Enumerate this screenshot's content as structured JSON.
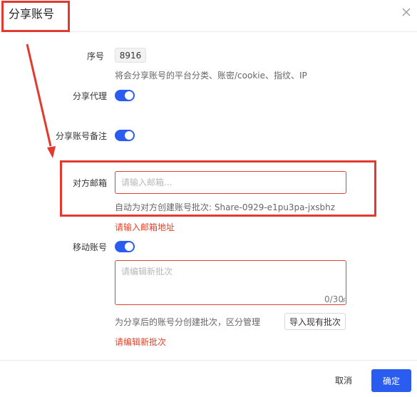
{
  "dialog": {
    "title": "分享账号",
    "close_icon": "close-icon"
  },
  "form": {
    "sequence": {
      "label": "序号",
      "value": "8916",
      "hint": "将会分享账号的平台分类、账密/cookie、指纹、IP"
    },
    "share_proxy": {
      "label": "分享代理",
      "enabled": true
    },
    "share_remark": {
      "label": "分享账号备注",
      "enabled": true
    },
    "email": {
      "label": "对方邮箱",
      "placeholder": "请输入邮箱...",
      "value": "",
      "hint": "自动为对方创建账号批次: Share-0929-e1pu3pa-jxsbhz",
      "error": "请输入邮箱地址"
    },
    "move_account": {
      "label": "移动账号",
      "enabled": true
    },
    "batch": {
      "placeholder": "请编辑新批次",
      "value": "",
      "counter": "0/30",
      "hint": "为分享后的账号分创建批次，区分管理",
      "import_label": "导入现有批次",
      "error": "请编辑新批次"
    }
  },
  "footer": {
    "cancel_label": "取消",
    "ok_label": "确定"
  },
  "colors": {
    "primary": "#2b5cf0",
    "error": "#e0442b",
    "annotation": "#e23a2e"
  }
}
